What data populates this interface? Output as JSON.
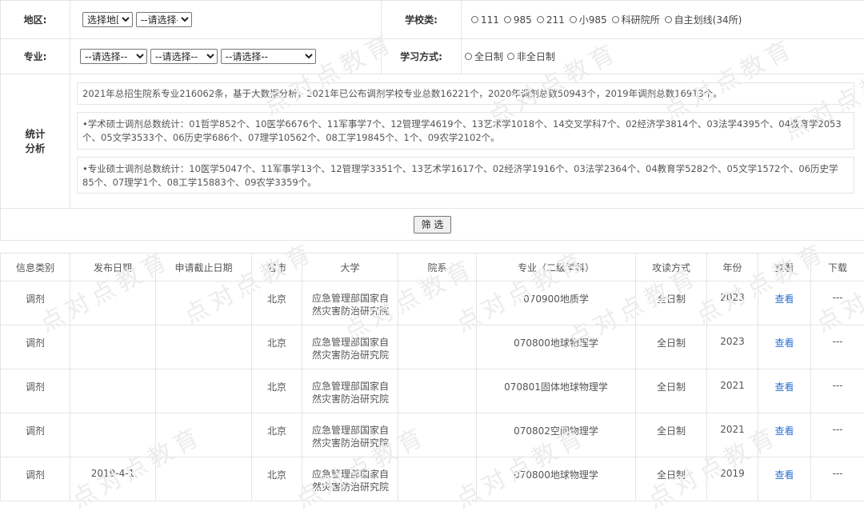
{
  "filter": {
    "region_label": "地区:",
    "region_selects": [
      "选择地区",
      "--请选择--"
    ],
    "school_type_label": "学校类:",
    "school_types": [
      "111",
      "985",
      "211",
      "小985",
      "科研院所",
      "自主划线(34所)"
    ],
    "major_label": "专业:",
    "major_selects": [
      "--请选择--",
      "--请选择--",
      "--请选择--"
    ],
    "study_mode_label": "学习方式:",
    "study_modes": [
      "全日制",
      "非全日制"
    ],
    "stats_label": "统计\n分析",
    "stats_line1": "2021年总招生院系专业216062条，基于大数据分析，2021年已公布调剂学校专业总数16221个，2020年调剂总数50943个，2019年调剂总数16913个。",
    "stats_line2": "•学术硕士调剂总数统计：01哲学852个、10医学6676个、11军事学7个、12管理学4619个、13艺术学1018个、14交叉学科7个、02经济学3814个、03法学4395个、04教育学2053个、05文学3533个、06历史学686个、07理学10562个、08工学19845个、1个、09农学2102个。",
    "stats_line3": "•专业硕士调剂总数统计：10医学5047个、11军事学13个、12管理学3351个、13艺术学1617个、02经济学1916个、03法学2364个、04教育学5282个、05文学1572个、06历史学85个、07理学1个、08工学15883个、09农学3359个。",
    "submit_label": "筛 选"
  },
  "table": {
    "headers": [
      "信息类别",
      "发布日期",
      "申请截止日期",
      "省市",
      "大学",
      "院系",
      "专业（二级学科）",
      "攻读方式",
      "年份",
      "查看",
      "下载"
    ],
    "rows": [
      {
        "type": "调剂",
        "pub_date": "",
        "deadline": "",
        "province": "北京",
        "university": "应急管理部国家自然灾害防治研究院",
        "department": "",
        "major": "070900地质学",
        "mode": "全日制",
        "year": "2023",
        "view": "查看",
        "download": "---"
      },
      {
        "type": "调剂",
        "pub_date": "",
        "deadline": "",
        "province": "北京",
        "university": "应急管理部国家自然灾害防治研究院",
        "department": "",
        "major": "070800地球物理学",
        "mode": "全日制",
        "year": "2023",
        "view": "查看",
        "download": "---"
      },
      {
        "type": "调剂",
        "pub_date": "",
        "deadline": "",
        "province": "北京",
        "university": "应急管理部国家自然灾害防治研究院",
        "department": "",
        "major": "070801固体地球物理学",
        "mode": "全日制",
        "year": "2021",
        "view": "查看",
        "download": "---"
      },
      {
        "type": "调剂",
        "pub_date": "",
        "deadline": "",
        "province": "北京",
        "university": "应急管理部国家自然灾害防治研究院",
        "department": "",
        "major": "070802空间物理学",
        "mode": "全日制",
        "year": "2021",
        "view": "查看",
        "download": "---"
      },
      {
        "type": "调剂",
        "pub_date": "2019-4-1",
        "deadline": "",
        "province": "北京",
        "university": "应急管理部国家自然灾害防治研究院",
        "department": "",
        "major": "070800地球物理学",
        "mode": "全日制",
        "year": "2019",
        "view": "查看",
        "download": "---"
      }
    ]
  },
  "watermark": "点对点教育",
  "colors": {
    "link": "#2a6fd6",
    "border": "#e4e4e4"
  }
}
